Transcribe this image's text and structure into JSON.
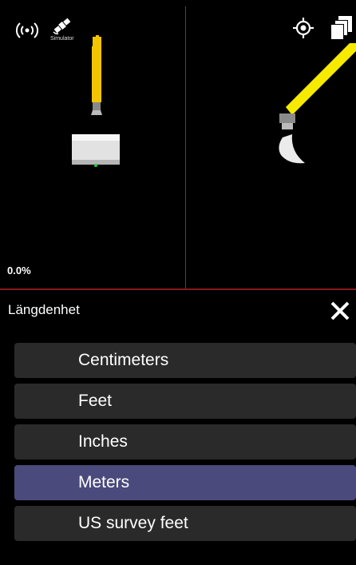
{
  "status_bar": {
    "antenna_icon": "wireless-antenna-icon",
    "satellite_icon": "satellite-icon",
    "satellite_label": "Simulator",
    "target_icon": "gps-target-icon",
    "layers_icon": "layers-icon"
  },
  "machine_view": {
    "slope_text": "0.0%",
    "colors": {
      "boom": "#f2c500",
      "bucket": "#e6e6e6",
      "arrow": "#f5ea00",
      "divider": "#8a1818"
    }
  },
  "panel": {
    "title": "Längdenhet",
    "close_icon": "close-icon",
    "options": [
      {
        "label": "Centimeters",
        "selected": false
      },
      {
        "label": "Feet",
        "selected": false
      },
      {
        "label": "Inches",
        "selected": false
      },
      {
        "label": "Meters",
        "selected": true
      },
      {
        "label": "US survey feet",
        "selected": false
      }
    ],
    "colors": {
      "option_bg": "#2a2a2a",
      "selected_bg": "#4a4a7c"
    }
  }
}
